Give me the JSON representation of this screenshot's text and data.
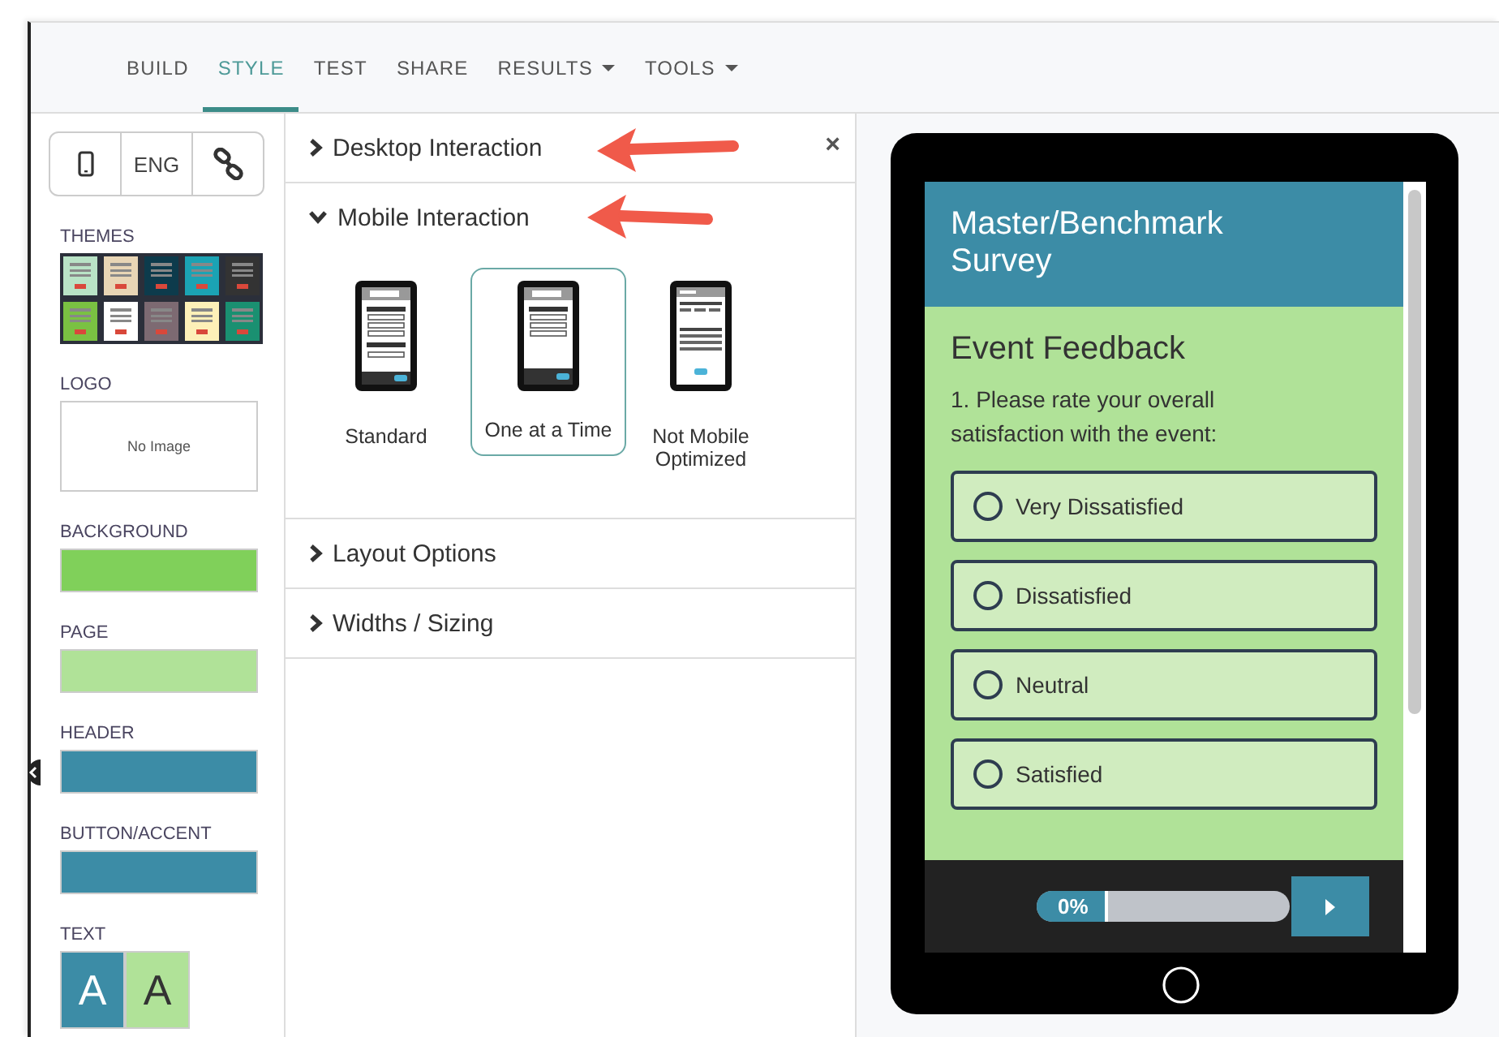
{
  "nav": {
    "tabs": [
      {
        "label": "BUILD",
        "selected": false,
        "dropdown": false
      },
      {
        "label": "STYLE",
        "selected": true,
        "dropdown": false
      },
      {
        "label": "TEST",
        "selected": false,
        "dropdown": false
      },
      {
        "label": "SHARE",
        "selected": false,
        "dropdown": false
      },
      {
        "label": "RESULTS",
        "selected": false,
        "dropdown": true
      },
      {
        "label": "TOOLS",
        "selected": false,
        "dropdown": true
      }
    ]
  },
  "sidebar": {
    "language": "ENG",
    "themes_label": "THEMES",
    "themes": [
      {
        "color": "#b9e3c6"
      },
      {
        "color": "#e8d5b5"
      },
      {
        "color": "#0d3b4c"
      },
      {
        "color": "#1ba3b4"
      },
      {
        "color": "#333333"
      },
      {
        "color": "#7ac142"
      },
      {
        "color": "#ffffff"
      },
      {
        "color": "#7d6a72"
      },
      {
        "color": "#fdf0b8"
      },
      {
        "color": "#1a9071"
      }
    ],
    "logo": {
      "label": "LOGO",
      "text": "No Image"
    },
    "colors": [
      {
        "label": "BACKGROUND",
        "color": "#80d05a"
      },
      {
        "label": "PAGE",
        "color": "#b0e298"
      },
      {
        "label": "HEADER",
        "color": "#3c8ca6"
      },
      {
        "label": "BUTTON/ACCENT",
        "color": "#3c8ca6"
      }
    ],
    "text_colors": {
      "label": "TEXT",
      "swatches": [
        {
          "glyph": "A",
          "color": "#3c8ca6"
        },
        {
          "glyph": "A",
          "color": "#b0e298"
        }
      ]
    }
  },
  "panel": {
    "close": "×",
    "sections": [
      {
        "title": "Desktop Interaction",
        "expanded": false
      },
      {
        "title": "Mobile Interaction",
        "expanded": true,
        "options": [
          {
            "label": "Standard",
            "kind": "standard",
            "selected": false
          },
          {
            "label": "One at a Time",
            "kind": "one-at-a-time",
            "selected": true
          },
          {
            "label": "Not Mobile Optimized",
            "kind": "not-optimized",
            "selected": false
          }
        ]
      },
      {
        "title": "Layout Options",
        "expanded": false
      },
      {
        "title": "Widths / Sizing",
        "expanded": false
      }
    ]
  },
  "preview": {
    "survey_title": "Master/Benchmark Survey",
    "page_title": "Event Feedback",
    "question": "1. Please rate your overall satisfaction with the event:",
    "choices": [
      {
        "label": "Very Dissatisfied",
        "selected": false
      },
      {
        "label": "Dissatisfied",
        "selected": false
      },
      {
        "label": "Neutral",
        "selected": false
      },
      {
        "label": "Satisfied",
        "selected": false
      }
    ],
    "progress": {
      "reading": "0%"
    }
  }
}
